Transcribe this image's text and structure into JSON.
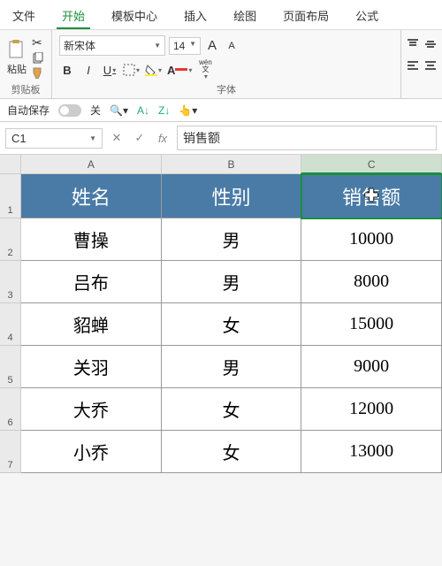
{
  "menu": {
    "file": "文件",
    "home": "开始",
    "template": "模板中心",
    "insert": "插入",
    "draw": "绘图",
    "layout": "页面布局",
    "formula": "公式"
  },
  "ribbon": {
    "clipboard": {
      "paste": "粘贴",
      "label": "剪贴板"
    },
    "font": {
      "name": "新宋体",
      "size": "14",
      "label": "字体",
      "bold": "B",
      "italic": "I",
      "underline": "U",
      "wen": "wén",
      "wen2": "文",
      "bigA": "A",
      "smallA": "A"
    }
  },
  "toolbar2": {
    "autosave": "自动保存",
    "off": "关"
  },
  "formula_bar": {
    "cell_ref": "C1",
    "fx": "fx",
    "value": "销售额"
  },
  "columns": [
    "A",
    "B",
    "C"
  ],
  "rows": [
    "1",
    "2",
    "3",
    "4",
    "5",
    "6",
    "7"
  ],
  "headers": [
    "姓名",
    "性别",
    "销售额"
  ],
  "data": [
    [
      "曹操",
      "男",
      "10000"
    ],
    [
      "吕布",
      "男",
      "8000"
    ],
    [
      "貂蝉",
      "女",
      "15000"
    ],
    [
      "关羽",
      "男",
      "9000"
    ],
    [
      "大乔",
      "女",
      "12000"
    ],
    [
      "小乔",
      "女",
      "13000"
    ]
  ],
  "chart_data": {
    "type": "table",
    "columns": [
      "姓名",
      "性别",
      "销售额"
    ],
    "rows": [
      {
        "姓名": "曹操",
        "性别": "男",
        "销售额": 10000
      },
      {
        "姓名": "吕布",
        "性别": "男",
        "销售额": 8000
      },
      {
        "姓名": "貂蝉",
        "性别": "女",
        "销售额": 15000
      },
      {
        "姓名": "关羽",
        "性别": "男",
        "销售额": 9000
      },
      {
        "姓名": "大乔",
        "性别": "女",
        "销售额": 12000
      },
      {
        "姓名": "小乔",
        "性别": "女",
        "销售额": 13000
      }
    ]
  }
}
